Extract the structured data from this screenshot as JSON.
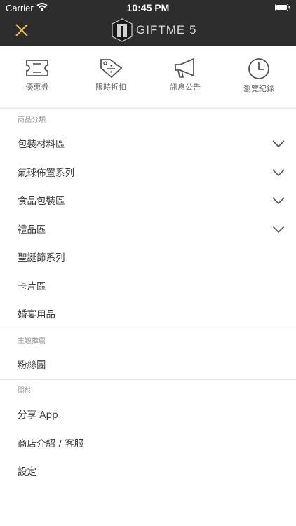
{
  "status": {
    "carrier": "Carrier",
    "time": "10:45 PM"
  },
  "header": {
    "logo_text": "GIFTME 5"
  },
  "quick_links": [
    {
      "label": "優惠券",
      "icon": "ticket-icon"
    },
    {
      "label": "限時折扣",
      "icon": "discount-tag-icon"
    },
    {
      "label": "訊息公告",
      "icon": "megaphone-icon"
    },
    {
      "label": "瀏覽紀錄",
      "icon": "clock-icon"
    }
  ],
  "sections": {
    "categories": {
      "title": "商品分類",
      "items": [
        "包裝材料區",
        "氣球佈置系列",
        "食品包裝區",
        "禮品區",
        "聖誕節系列",
        "卡片區",
        "婚宴用品"
      ]
    },
    "themes": {
      "title": "主題推薦",
      "items": [
        "粉絲團"
      ]
    },
    "about": {
      "title": "關於",
      "items": [
        "分享 App",
        "商店介紹 / 客服",
        "設定"
      ]
    }
  },
  "colors": {
    "header_bg": "#2d2d2d",
    "accent": "#e9b94a",
    "separator": "#eeeeee"
  }
}
